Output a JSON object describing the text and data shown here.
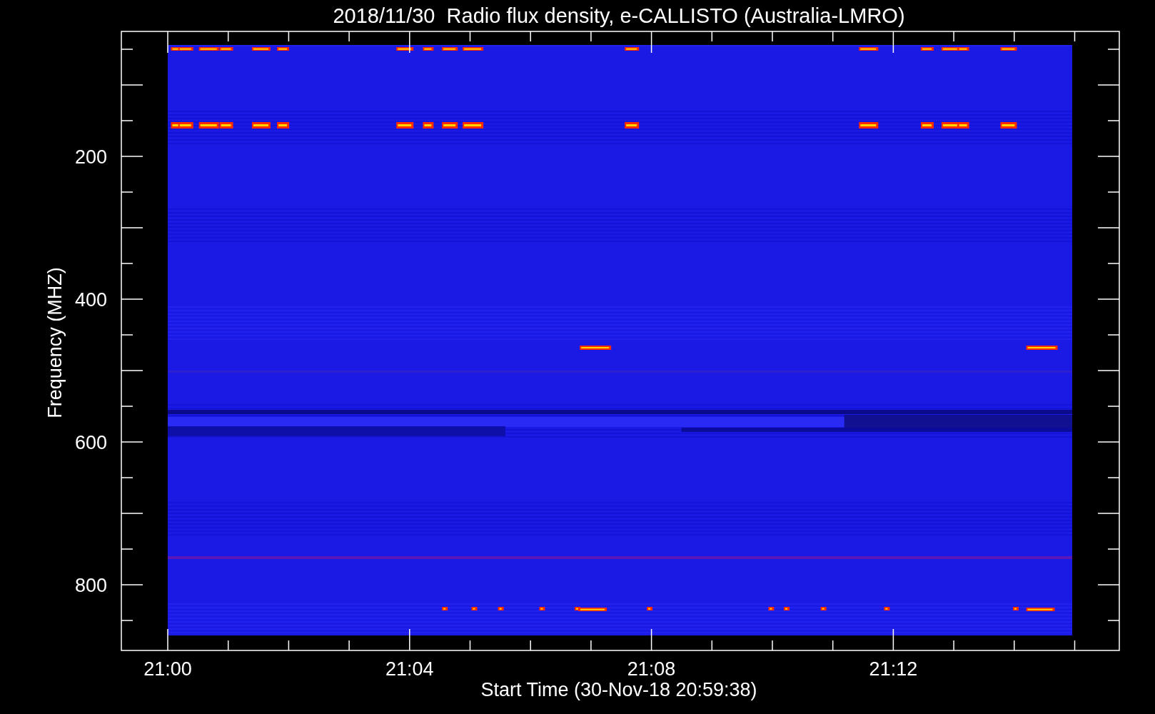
{
  "title": "2018/11/30  Radio flux density, e-CALLISTO (Australia-LMRO)",
  "y_axis": {
    "label": "Frequency (MHZ)",
    "ticks": [
      "200",
      "400",
      "600",
      "800"
    ]
  },
  "x_axis": {
    "label": "Start Time (30-Nov-18 20:59:38)",
    "ticks": [
      "21:00",
      "21:04",
      "21:08",
      "21:12"
    ]
  }
}
